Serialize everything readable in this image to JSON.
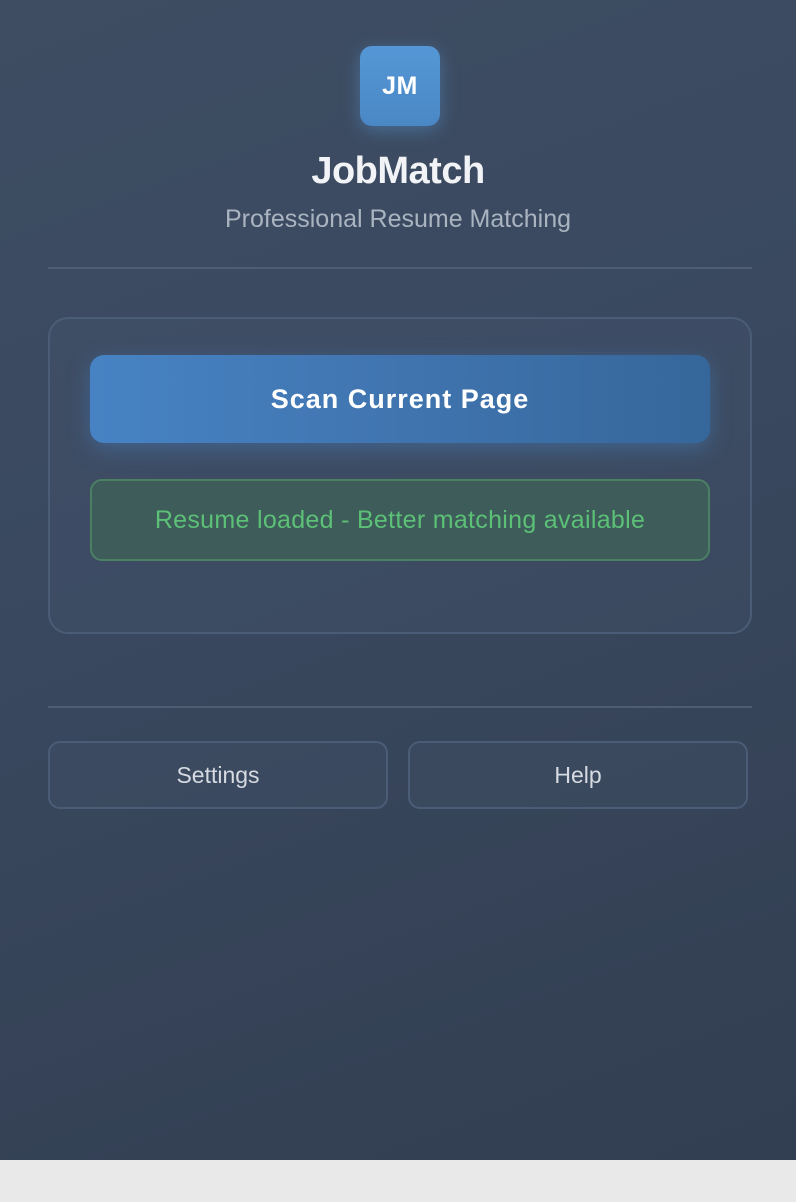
{
  "app": {
    "logo_text": "JM",
    "title": "JobMatch",
    "subtitle": "Professional Resume Matching"
  },
  "actions": {
    "scan_label": "Scan Current Page"
  },
  "status": {
    "message": "Resume loaded - Better matching available",
    "color": "#5cc177"
  },
  "footer": {
    "settings_label": "Settings",
    "help_label": "Help"
  },
  "colors": {
    "accent": "#4783c4",
    "background": "#3a4960",
    "success": "#5cc177"
  }
}
